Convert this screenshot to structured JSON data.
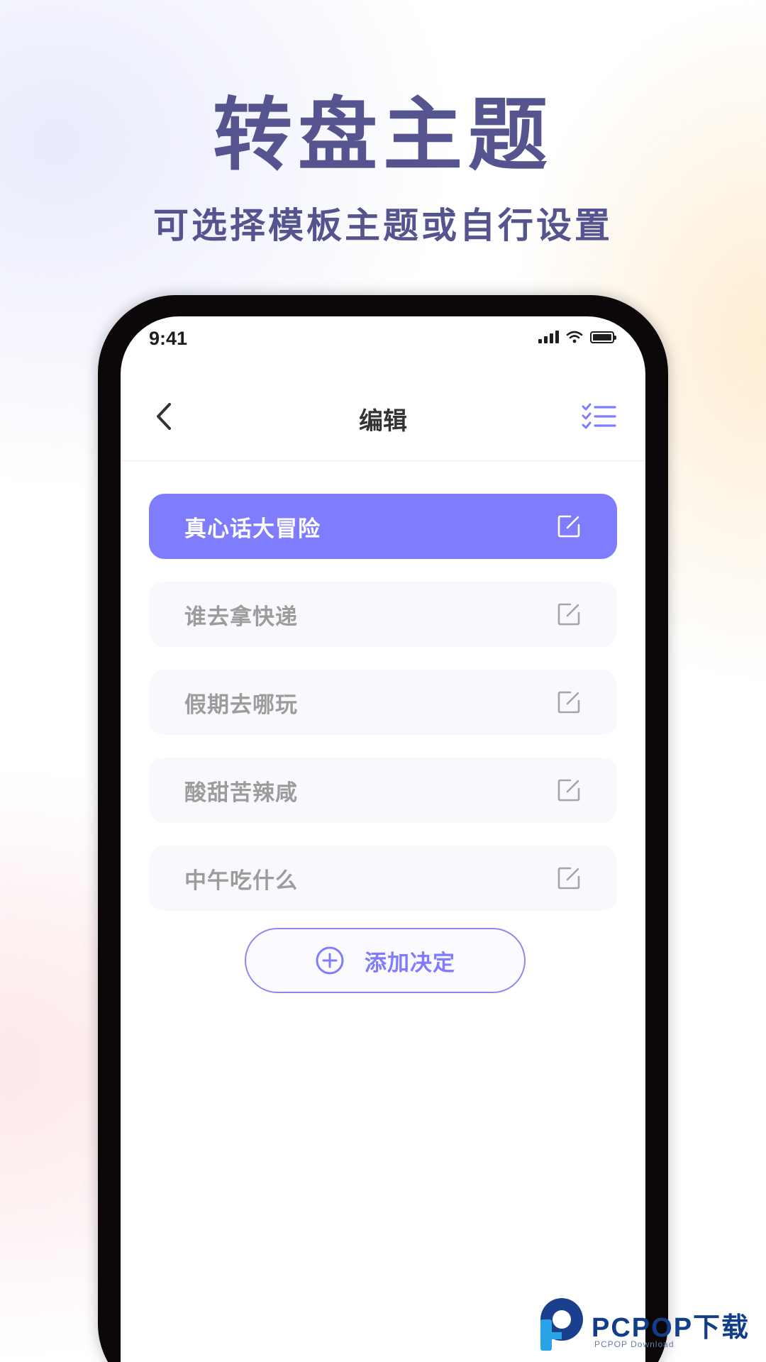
{
  "promo": {
    "title": "转盘主题",
    "subtitle": "可选择模板主题或自行设置"
  },
  "status_bar": {
    "time": "9:41"
  },
  "nav": {
    "title": "编辑",
    "back_icon": "chevron-left-icon",
    "list_icon": "checklist-icon"
  },
  "themes": {
    "items": [
      {
        "label": "真心话大冒险",
        "active": true
      },
      {
        "label": "谁去拿快递",
        "active": false
      },
      {
        "label": "假期去哪玩",
        "active": false
      },
      {
        "label": "酸甜苦辣咸",
        "active": false
      },
      {
        "label": "中午吃什么",
        "active": false
      }
    ]
  },
  "add_button": {
    "label": "添加决定",
    "icon": "plus-circle-icon"
  },
  "watermark": {
    "brand": "PCPOP下载",
    "sub": "PCPOP Download"
  },
  "colors": {
    "accent": "#7f7cfd",
    "promo_text": "#55548f",
    "inactive_text": "#9c9c9c"
  }
}
